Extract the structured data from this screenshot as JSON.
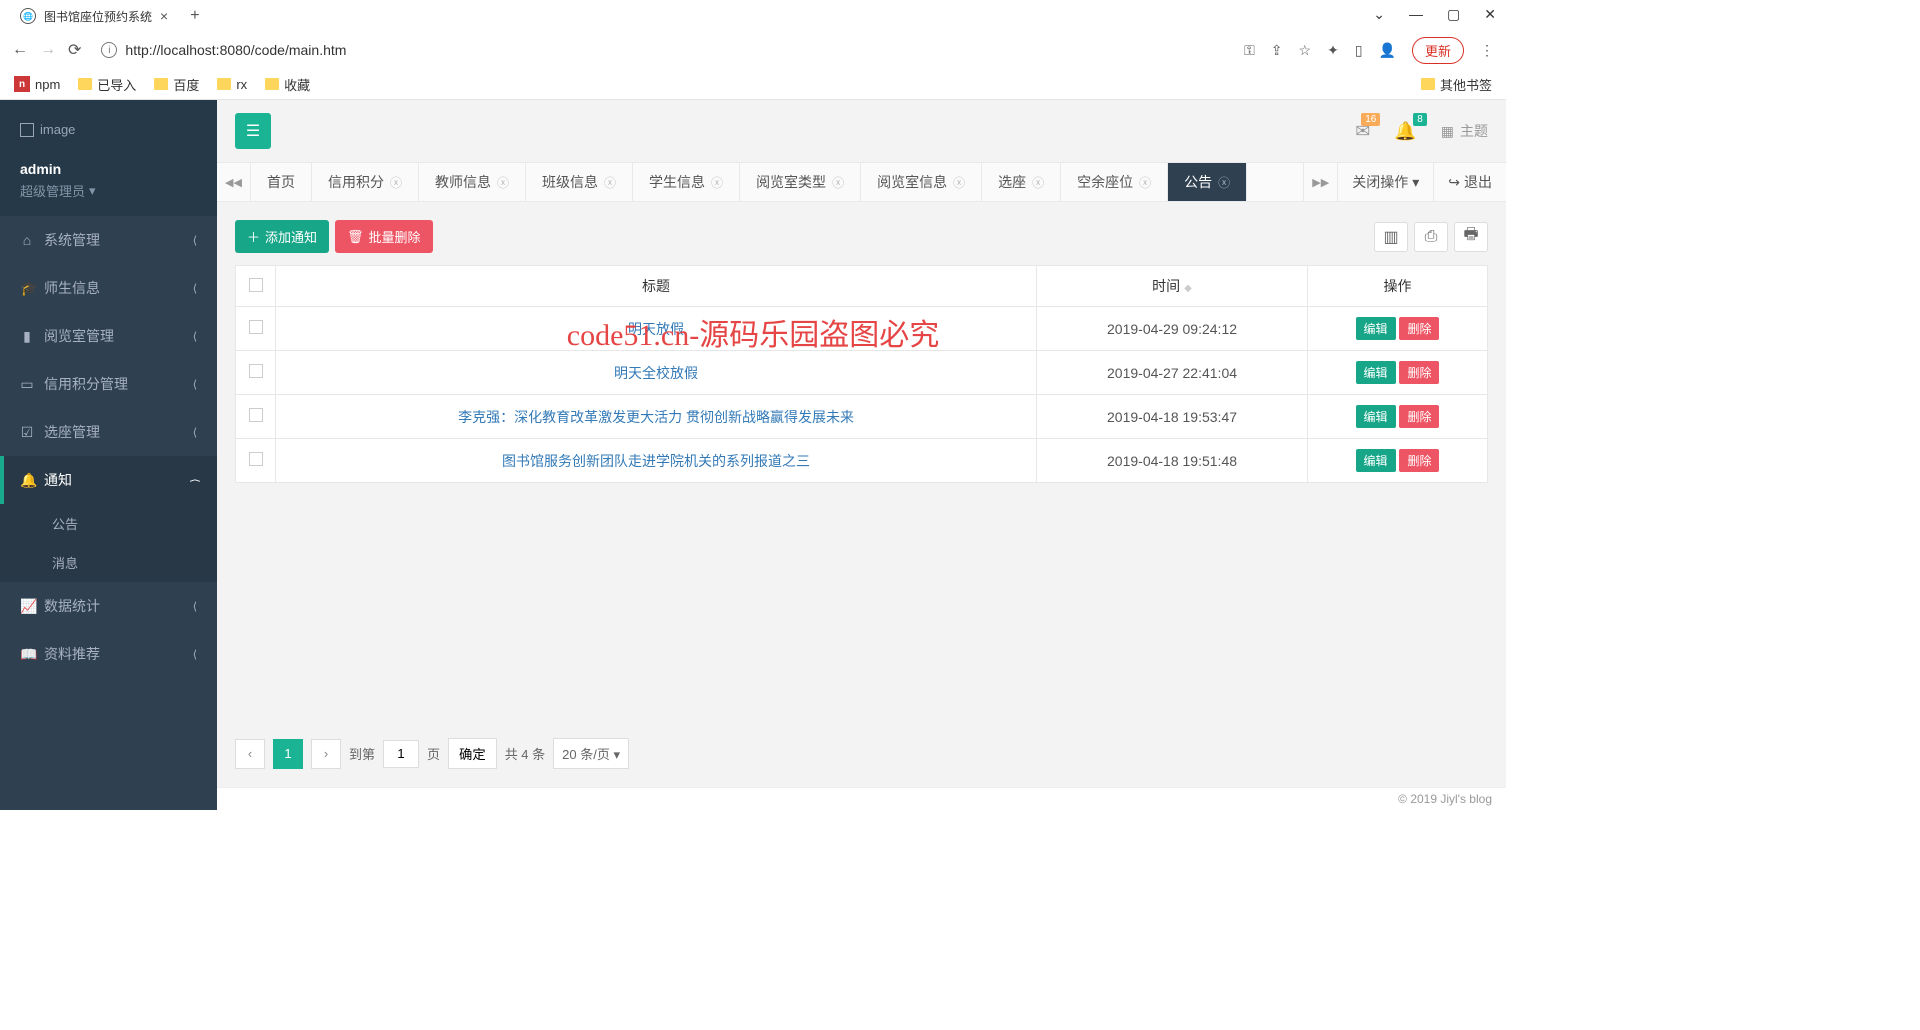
{
  "browser": {
    "tab_title": "图书馆座位预约系统",
    "url": "http://localhost:8080/code/main.htm",
    "update_label": "更新",
    "bookmarks": [
      "npm",
      "已导入",
      "百度",
      "rx",
      "收藏"
    ],
    "other_bookmarks": "其他书签"
  },
  "sidebar": {
    "logo_text": "image",
    "username": "admin",
    "role": "超级管理员",
    "items": [
      {
        "label": "系统管理",
        "icon": "⌂"
      },
      {
        "label": "师生信息",
        "icon": "🎓"
      },
      {
        "label": "阅览室管理",
        "icon": "▮"
      },
      {
        "label": "信用积分管理",
        "icon": "▭"
      },
      {
        "label": "选座管理",
        "icon": "☑"
      },
      {
        "label": "通知",
        "icon": "🔔",
        "active": true,
        "children": [
          "公告",
          "消息"
        ]
      },
      {
        "label": "数据统计",
        "icon": "📈"
      },
      {
        "label": "资料推荐",
        "icon": "📖"
      }
    ]
  },
  "topbar": {
    "mail_badge": "16",
    "bell_badge": "8",
    "theme_label": "主题"
  },
  "tabstrip": {
    "tabs": [
      "首页",
      "信用积分",
      "教师信息",
      "班级信息",
      "学生信息",
      "阅览室类型",
      "阅览室信息",
      "选座",
      "空余座位",
      "公告"
    ],
    "active_index": 9,
    "close_ops": "关闭操作",
    "logout": "退出"
  },
  "toolbar": {
    "add_label": "添加通知",
    "bulk_delete_label": "批量删除"
  },
  "table": {
    "headers": [
      "",
      "标题",
      "时间",
      "操作"
    ],
    "sort_icon": "◆",
    "rows": [
      {
        "title": "明天放假",
        "time": "2019-04-29 09:24:12"
      },
      {
        "title": "明天全校放假",
        "time": "2019-04-27 22:41:04"
      },
      {
        "title": "李克强：深化教育改革激发更大活力 贯彻创新战略赢得发展未来",
        "time": "2019-04-18 19:53:47"
      },
      {
        "title": "图书馆服务创新团队走进学院机关的系列报道之三",
        "time": "2019-04-18 19:51:48"
      }
    ],
    "edit_label": "编辑",
    "delete_label": "删除"
  },
  "pagination": {
    "current": "1",
    "goto_label": "到第",
    "page_unit": "页",
    "confirm": "确定",
    "total": "共 4 条",
    "per_page": "20 条/页"
  },
  "footer": "© 2019 Jiyl's blog",
  "watermark": "code51.cn-源码乐园盗图必究"
}
